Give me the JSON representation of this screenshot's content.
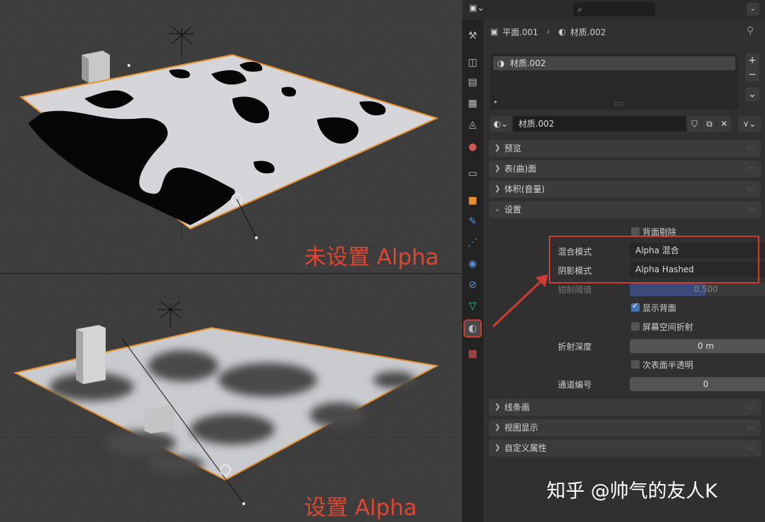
{
  "viewport_top": {
    "caption": "未设置 Alpha"
  },
  "viewport_bottom": {
    "caption": "设置 Alpha"
  },
  "properties": {
    "header": {
      "search_placeholder": "",
      "editor_icon": "properties-editor-icon"
    },
    "breadcrumb": {
      "object": "平面.001",
      "material": "材质.002"
    },
    "slots": [
      {
        "label": "材质.002"
      }
    ],
    "slot_buttons": {
      "add": "+",
      "remove": "−",
      "menu": "⌄"
    },
    "material_field": {
      "name": "材质.002"
    },
    "panels": {
      "preview": "预览",
      "surface": "表(曲)面",
      "volume": "体积(音量)",
      "settings": "设置",
      "lineart": "线条画",
      "viewport_display": "视图显示",
      "custom_props": "自定义属性"
    },
    "settings": {
      "backface_culling": {
        "label": "背面剔除",
        "checked": false
      },
      "blend_mode": {
        "label": "混合模式",
        "value": "Alpha 混合"
      },
      "shadow_mode": {
        "label": "阴影模式",
        "value": "Alpha Hashed"
      },
      "clip_threshold": {
        "label": "钳制阈值",
        "value": "0.500"
      },
      "show_backface": {
        "label": "显示背面",
        "checked": true
      },
      "screen_space_refraction": {
        "label": "屏幕空间折射",
        "checked": false
      },
      "refraction_depth": {
        "label": "折射深度",
        "value": "0 m"
      },
      "subsurface_translucency": {
        "label": "次表面半透明",
        "checked": false
      },
      "pass_index": {
        "label": "通道编号",
        "value": "0"
      }
    }
  },
  "watermark": "知乎 @帅气的友人K",
  "colors": {
    "annotation": "#d23b33",
    "selection_outline": "#e8912d",
    "accent": "#4772b3"
  }
}
